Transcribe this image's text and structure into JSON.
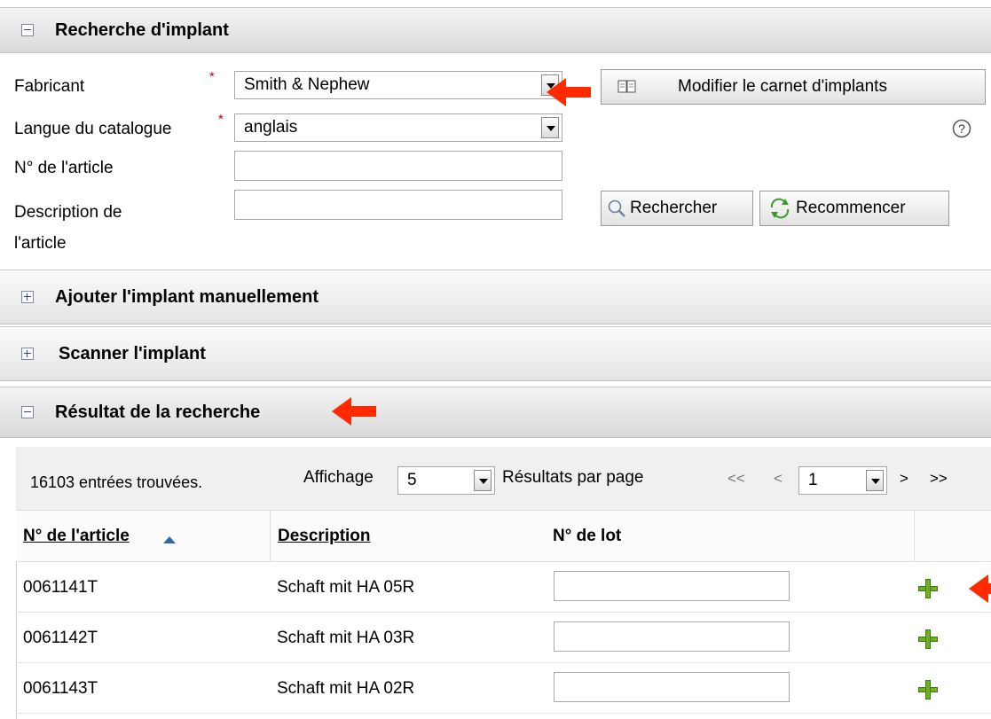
{
  "search_section": {
    "title": "Recherche d'implant",
    "manufacturer_label": "Fabricant",
    "manufacturer_value": "Smith & Nephew",
    "language_label": "Langue du catalogue",
    "language_value": "anglais",
    "article_no_label": "N° de l'article",
    "article_no_value": "",
    "description_label_line1": "Description de",
    "description_label_line2": "l'article",
    "description_value": "",
    "required_mark": "*",
    "edit_catalog_button": "Modifier le carnet d'implants",
    "help_glyph": "?",
    "search_button": "Rechercher",
    "reset_button": "Recommencer"
  },
  "manual_section": {
    "title": "Ajouter l'implant manuellement"
  },
  "scan_section": {
    "title": "Scanner l'implant"
  },
  "results_section": {
    "title": "Résultat de la recherche",
    "count_text": "16103 entrées trouvées.",
    "display_label": "Affichage",
    "per_page_value": "5",
    "per_page_label": "Résultats par page",
    "first_page": "<<",
    "prev_page": "<",
    "page_value": "1",
    "next_page": ">",
    "last_page": ">>",
    "columns": [
      "N° de l'article",
      "Description",
      "N° de lot"
    ],
    "rows": [
      {
        "article_no": "0061141T",
        "description": "Schaft mit HA 05R",
        "lot": ""
      },
      {
        "article_no": "0061142T",
        "description": "Schaft mit HA 03R",
        "lot": ""
      },
      {
        "article_no": "0061143T",
        "description": "Schaft mit HA 02R",
        "lot": ""
      }
    ]
  },
  "colors": {
    "accent_arrow": "#ff2a00",
    "required": "#d00000",
    "add_icon": "#6fb020"
  }
}
